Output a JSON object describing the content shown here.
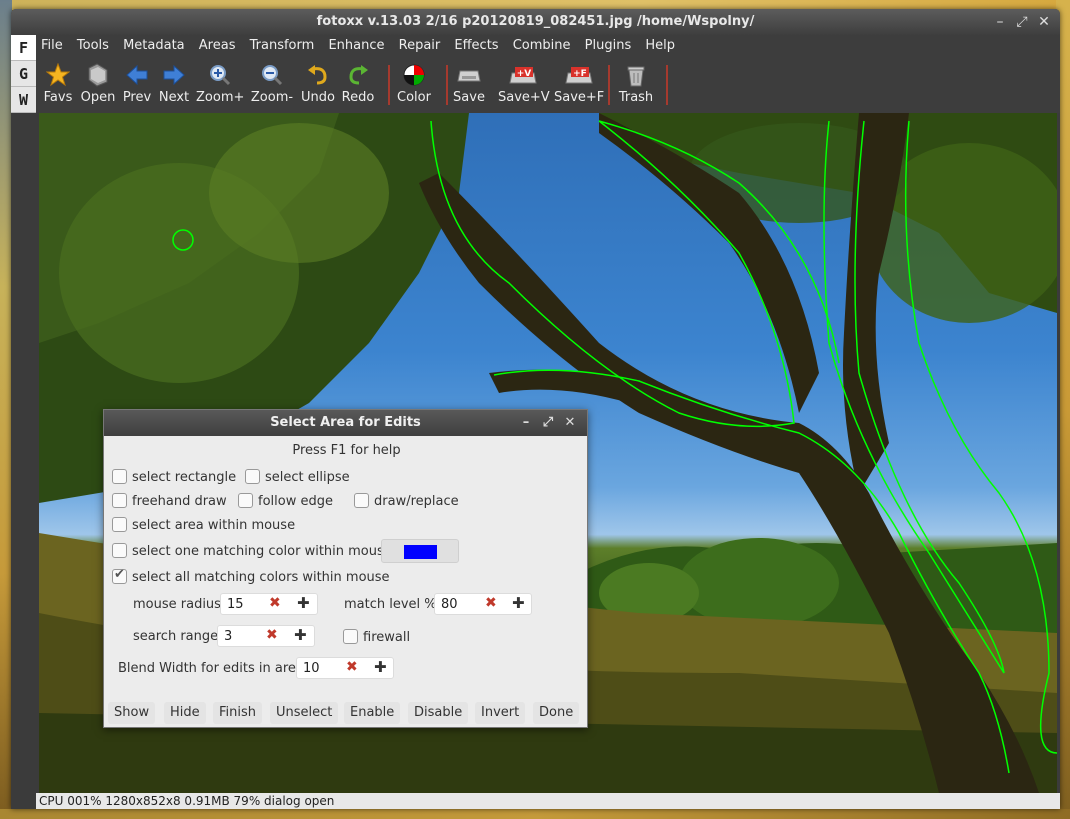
{
  "window": {
    "title": "fotoxx v.13.03  2/16  p20120819_082451.jpg  /home/Wspolny/",
    "controls": [
      "–",
      "⤢",
      "✕"
    ]
  },
  "side_tabs": [
    "F",
    "G",
    "W"
  ],
  "menu": [
    "File",
    "Tools",
    "Metadata",
    "Areas",
    "Transform",
    "Enhance",
    "Repair",
    "Effects",
    "Combine",
    "Plugins",
    "Help"
  ],
  "toolbar": {
    "favs": "Favs",
    "open": "Open",
    "prev": "Prev",
    "next": "Next",
    "zoom_in": "Zoom+",
    "zoom_out": "Zoom-",
    "undo": "Undo",
    "redo": "Redo",
    "color": "Color",
    "save": "Save",
    "save_v": "Save+V",
    "save_f": "Save+F",
    "trash": "Trash"
  },
  "status": "CPU 001%  1280x852x8  0.91MB  79%  dialog open",
  "dialog": {
    "title": "Select Area for Edits",
    "controls": [
      "–",
      "⤢",
      "✕"
    ],
    "help": "Press F1 for help",
    "select_rectangle": "select rectangle",
    "select_ellipse": "select ellipse",
    "freehand_draw": "freehand draw",
    "follow_edge": "follow edge",
    "draw_replace": "draw/replace",
    "within_mouse": "select area within mouse",
    "one_color": "select one matching color within mouse",
    "all_colors": "select all matching colors within mouse",
    "mouse_radius_label": "mouse radius",
    "mouse_radius": "15",
    "match_level_label": "match level %",
    "match_level": "80",
    "search_range_label": "search range",
    "search_range": "3",
    "firewall": "firewall",
    "blend_label": "Blend Width for edits in area",
    "blend": "10",
    "buttons": {
      "show": "Show",
      "hide": "Hide",
      "finish": "Finish",
      "unselect": "Unselect",
      "enable": "Enable",
      "disable": "Disable",
      "invert": "Invert",
      "done": "Done"
    }
  },
  "colors": {
    "selection_outline": "#00ff00",
    "match_color": "#0000ff"
  }
}
